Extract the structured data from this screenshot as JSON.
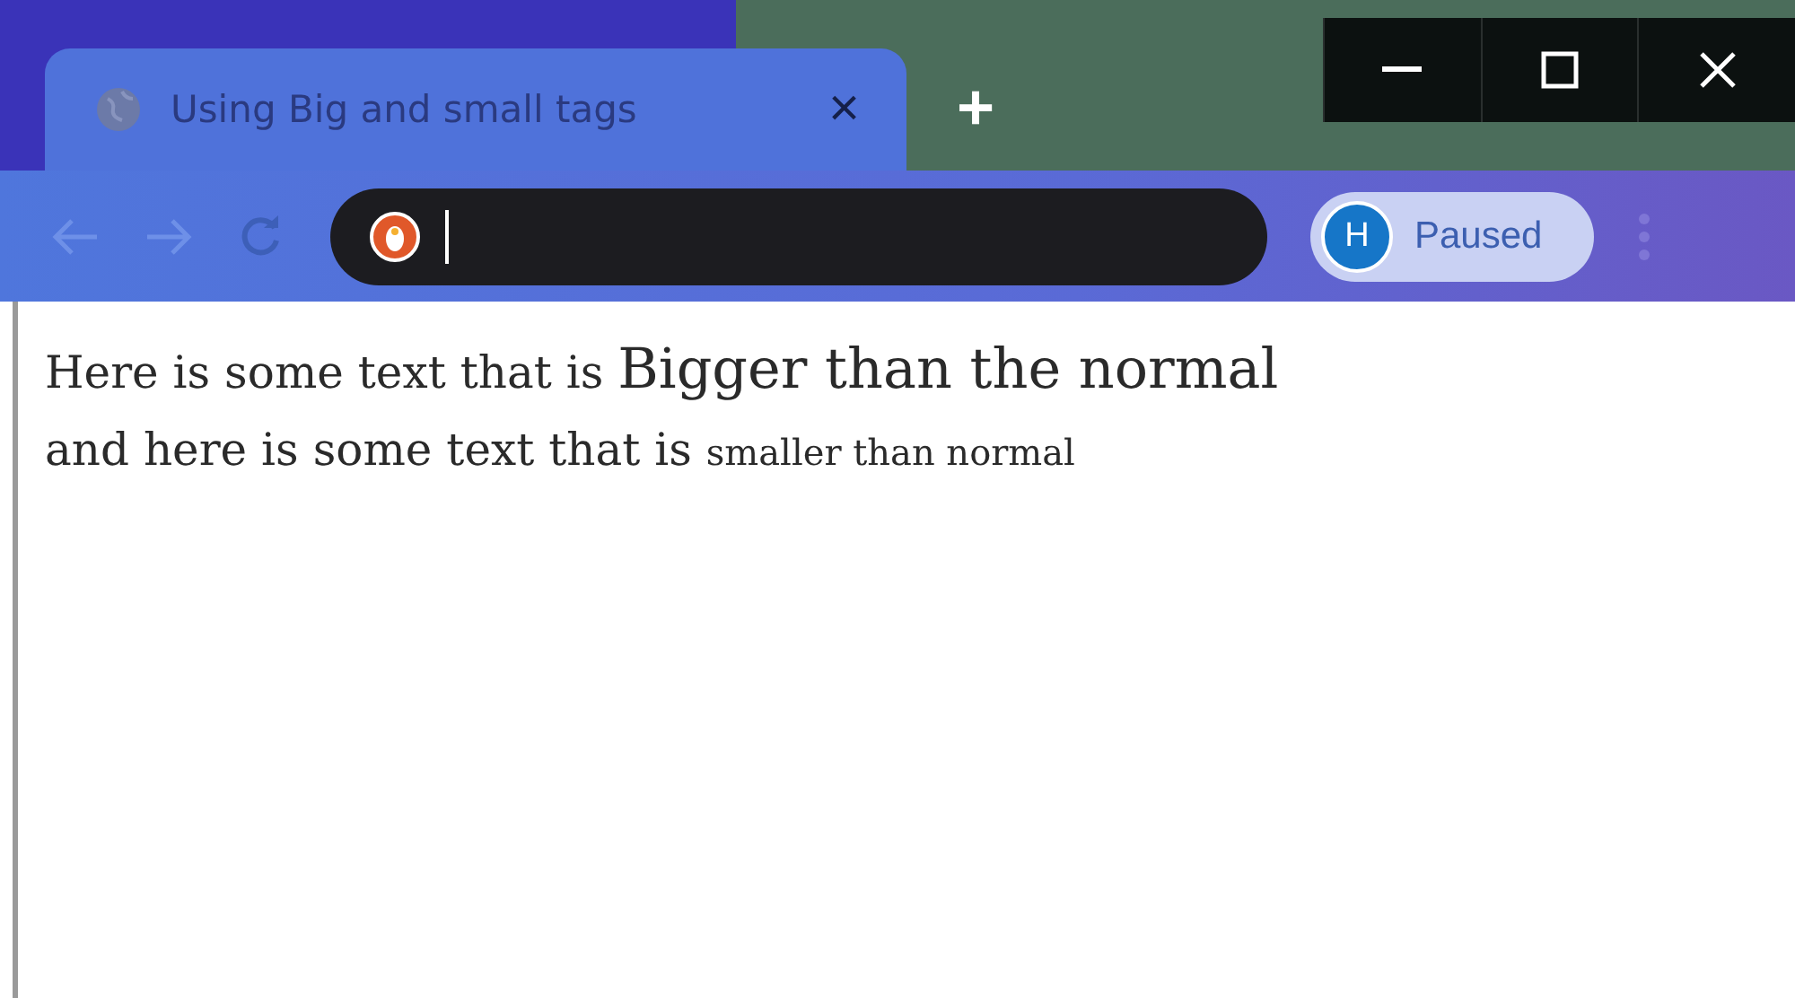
{
  "tab": {
    "title": "Using Big and small tags",
    "close": "×",
    "selected": true
  },
  "new_tab": "+",
  "profile": {
    "initial": "H",
    "label": "Paused"
  },
  "content": {
    "lines": [
      {
        "parts": [
          {
            "text": "Here is some text that is ",
            "kind": "normal"
          },
          {
            "text": "Bigger than the normal",
            "kind": "big"
          }
        ]
      },
      {
        "parts": [
          {
            "text": "and here is some text that is ",
            "kind": "normal"
          },
          {
            "text": "smaller than normal",
            "kind": "small"
          }
        ]
      }
    ]
  }
}
